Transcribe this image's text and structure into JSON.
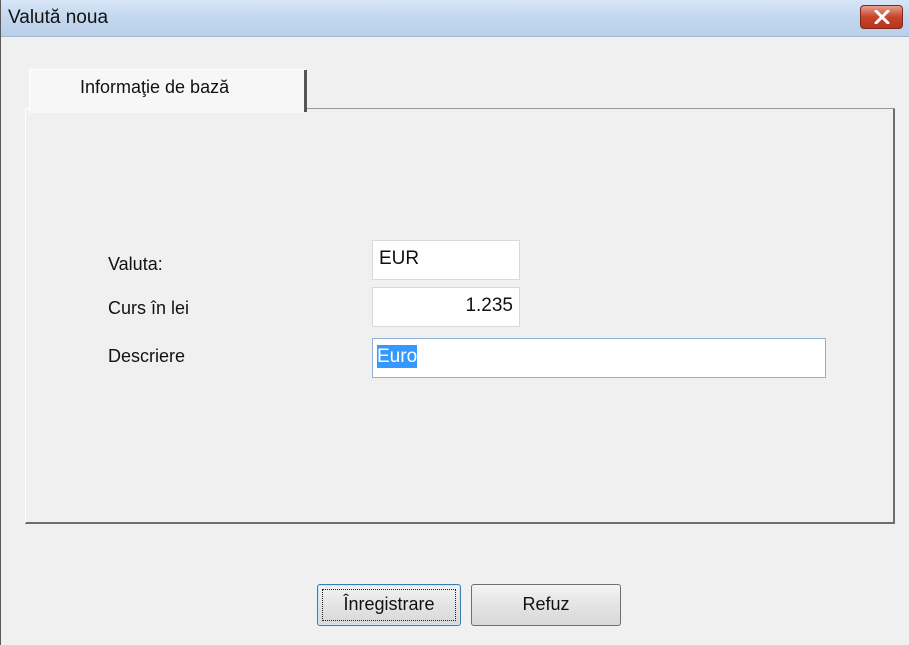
{
  "window": {
    "title": "Valută noua",
    "close_icon": "close-x-icon"
  },
  "tabs": [
    {
      "label": "Informaţie de bază",
      "active": true
    }
  ],
  "form": {
    "valuta": {
      "label": "Valuta:",
      "value": "EUR"
    },
    "curs": {
      "label": "Curs în lei",
      "value": "1.235"
    },
    "descriere": {
      "label": "Descriere",
      "value": "Euro",
      "selected": true
    }
  },
  "buttons": {
    "save_label": "Înregistrare",
    "cancel_label": "Refuz"
  },
  "colors": {
    "selection": "#3399ff",
    "title_bar": "#c3d7ee",
    "close_button": "#c7442c"
  }
}
